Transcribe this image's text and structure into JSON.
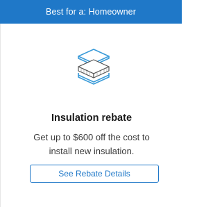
{
  "header": {
    "label": "Best for a: Homeowner"
  },
  "card": {
    "icon": "insulation-layers-icon",
    "title": "Insulation rebate",
    "description": "Get up to $600 off the cost to install new insulation.",
    "button_label": "See Rebate Details"
  },
  "colors": {
    "accent": "#1f78c8",
    "icon_stroke": "#3a9bd9",
    "text_dark": "#1a1a1a",
    "text_body": "#3a3a3a"
  }
}
